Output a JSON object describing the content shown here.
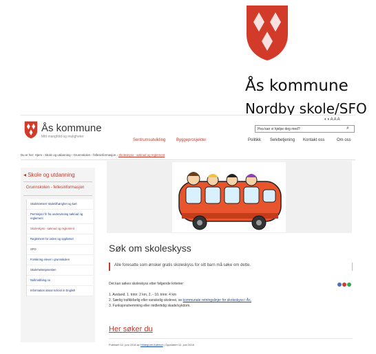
{
  "branding": {
    "kommune_title": "Ås kommune",
    "school_title": "Nordby skole/SFO",
    "crest_color": "#d23a2a"
  },
  "site": {
    "name": "Ås kommune",
    "tagline": "Mitt mangfold og muligheter",
    "access_text": "A A A",
    "search_placeholder": "Hva kan vi hjelpe deg med?",
    "nav_primary": [
      "Sentrumsutvikling",
      "Byggeprosjekter"
    ],
    "nav_secondary": [
      "Politikk",
      "Selvbetjening",
      "Kontakt oss",
      "Om oss"
    ],
    "breadcrumb": {
      "prefix": "Du er her:",
      "items": [
        "Hjem",
        "Skole og utdanning",
        "Grunnskolen - fellesinformasjon"
      ],
      "active": "Skoleskyss - søknad og reglement",
      "separator": "›"
    },
    "left_nav": {
      "heading": "Skole og utdanning",
      "subheading": "Grunnskolen - fellesinformasjon",
      "items": [
        "Skolekretser/ skoletilhørighet og kart",
        "Permisjon/ fri fra undervisning søknad og reglement",
        "Skoleskyss - søknad og reglement",
        "Reglement for orden og oppførsel",
        "SFO",
        "Forsikring elever i grunnskolen",
        "Skolehelsetjenesten",
        "Nullmobbing.no",
        "Information about school in English"
      ]
    },
    "main": {
      "title": "Søk om skoleskyss",
      "lead": "Alle foresatte som ønsker gratis skoleskyss for sitt barn må søke om dette.",
      "intro": "Det kan søkes skoleskyss etter følgende kriterier:",
      "criteria_1": "1. Avstand. 1. trinn: 2 km,  2. - 10. trinn: 4 km",
      "criteria_2_prefix": "2. Særlig trafikkfarlig eller vanskelig skolevei, se ",
      "criteria_2_link": "kommunale retningslinjer for skoleskyss i Ås.",
      "criteria_3": "3. Funksjonshemming eller midlertidig skade/sykdom.",
      "apply_link": "Her søker du",
      "published_prefix": "Publisert 12. juni 2018 av ",
      "published_author": "Hildegunn Aalerud",
      "published_suffix": " | Oppdatert 12. juni 2018"
    },
    "share_colors": [
      "#4a6fc0",
      "#d23a2a",
      "#3aa35a"
    ]
  }
}
